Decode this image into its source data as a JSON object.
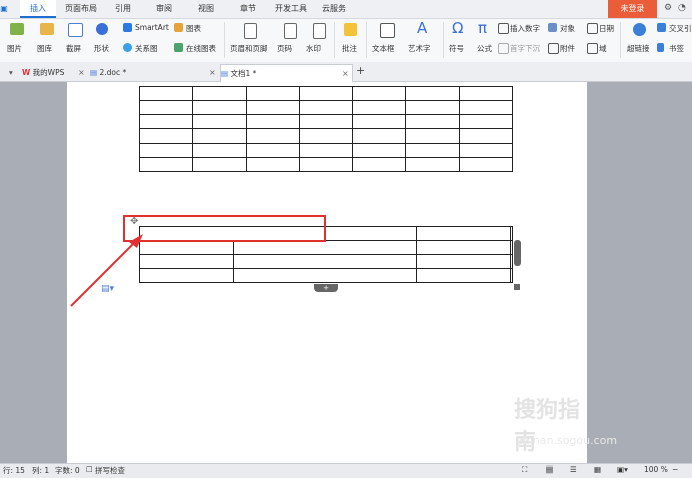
{
  "menu": {
    "items": [
      "插入",
      "页面布局",
      "引用",
      "审阅",
      "视图",
      "章节",
      "开发工具",
      "云服务"
    ],
    "active_index": 0,
    "login_label": "未登录"
  },
  "ribbon": {
    "picture": "图片",
    "gallery": "图库",
    "screenshot": "截屏",
    "shapes": "形状",
    "smartart": "SmartArt",
    "chart": "图表",
    "relation": "关系图",
    "online_chart": "在线图表",
    "header_footer": "页眉和页脚",
    "page_number": "页码",
    "watermark": "水印",
    "comment": "批注",
    "textbox": "文本框",
    "wordart": "艺术字",
    "symbol": "符号",
    "formula": "公式",
    "insert_number": "插入数字",
    "object": "对象",
    "date": "日期",
    "dropcap": "首字下沉",
    "attachment": "附件",
    "field": "域",
    "hyperlink": "超链接",
    "bookmark": "书签",
    "crossref": "交叉引"
  },
  "tabs": [
    {
      "label": "我的WPS"
    },
    {
      "label": "2.doc *"
    },
    {
      "label": "文档1 *"
    }
  ],
  "status": {
    "row": "行: 15",
    "col": "列: 1",
    "wordcount": "字数: 0",
    "spellcheck": "拼写检查",
    "zoom": "100 %"
  },
  "watermark": {
    "text": "搜狗指南",
    "url": "zhinan.sogou.com"
  },
  "colors": {
    "accent": "#1e6fd1",
    "login": "#ea5d38",
    "highlight": "#e03030"
  }
}
